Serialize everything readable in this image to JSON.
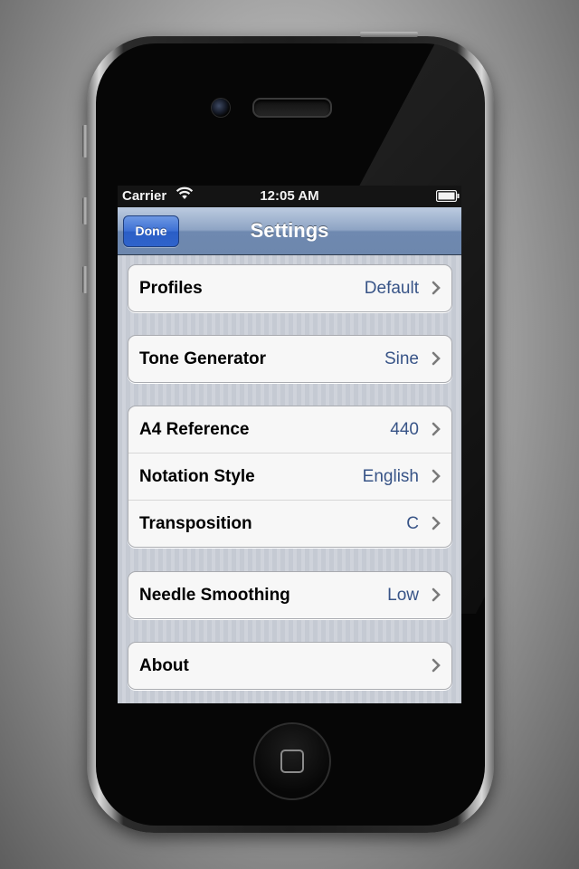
{
  "status_bar": {
    "carrier": "Carrier",
    "time": "12:05 AM",
    "icons": [
      "wifi-icon",
      "battery-icon"
    ]
  },
  "nav": {
    "title": "Settings",
    "done_label": "Done"
  },
  "settings": {
    "profiles": {
      "label": "Profiles",
      "value": "Default"
    },
    "tone_generator": {
      "label": "Tone Generator",
      "value": "Sine"
    },
    "a4_reference": {
      "label": "A4 Reference",
      "value": "440"
    },
    "notation_style": {
      "label": "Notation Style",
      "value": "English"
    },
    "transposition": {
      "label": "Transposition",
      "value": "C"
    },
    "needle_smoothing": {
      "label": "Needle Smoothing",
      "value": "Low"
    },
    "about": {
      "label": "About"
    }
  },
  "colors": {
    "value_text": "#385487",
    "nav_bar": "#8ea4c4",
    "done_button": "#3c6fd4"
  }
}
